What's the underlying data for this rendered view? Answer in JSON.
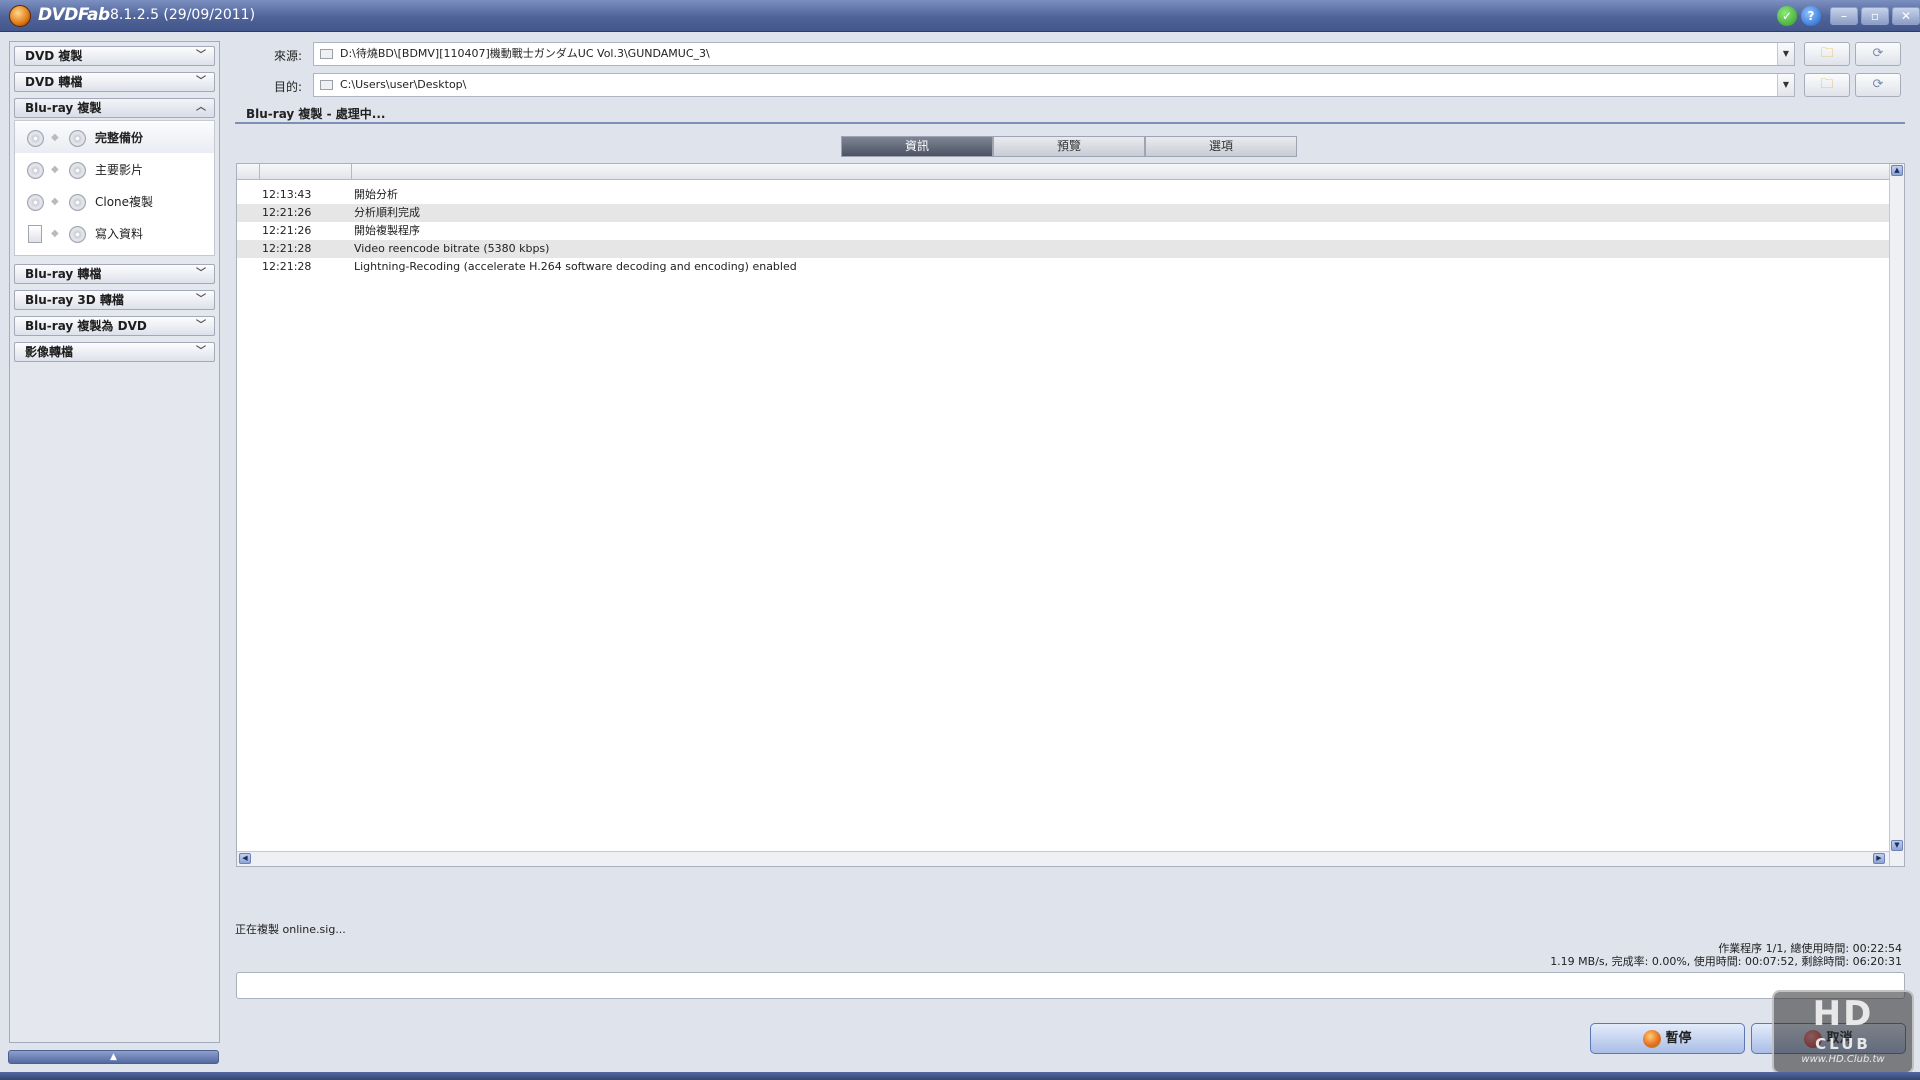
{
  "window": {
    "app_name": "DVDFab",
    "version": "8.1.2.5 (29/09/2011)"
  },
  "sidebar": {
    "categories": {
      "dvd_copy": "DVD 複製",
      "dvd_convert": "DVD 轉檔",
      "bluray_copy": "Blu-ray 複製",
      "bluray_convert": "Blu-ray 轉檔",
      "bluray_3d": "Blu-ray 3D 轉檔",
      "bluray_to_dvd": "Blu-ray 複製為 DVD",
      "video_convert": "影像轉檔"
    },
    "bluray_copy_modes": [
      "完整備份",
      "主要影片",
      "Clone複製",
      "寫入資料"
    ],
    "active_mode": "完整備份"
  },
  "paths": {
    "source_label": "來源:",
    "source_value": "D:\\待燒BD\\[BDMV][110407]機動戰士ガンダムUC Vol.3\\GUNDAMUC_3\\",
    "target_label": "目的:",
    "target_value": "C:\\Users\\user\\Desktop\\"
  },
  "main": {
    "section_title": "Blu-ray 複製 - 處理中...",
    "tabs": [
      "資訊",
      "預覽",
      "選項"
    ],
    "active_tab": "資訊"
  },
  "log": [
    {
      "time": "12:13:43",
      "message": "開始分析"
    },
    {
      "time": "12:21:26",
      "message": "分析順利完成"
    },
    {
      "time": "12:21:26",
      "message": "開始複製程序"
    },
    {
      "time": "12:21:28",
      "message": "Video reencode bitrate (5380 kbps)"
    },
    {
      "time": "12:21:28",
      "message": "Lightning-Recoding (accelerate H.264 software decoding and encoding) enabled"
    }
  ],
  "status": {
    "current_action": "正在複製 online.sig...",
    "stats_line1": "作業程序 1/1, 總使用時間: 00:22:54",
    "stats_line2": "1.19 MB/s, 完成率: 0.00%, 使用時間: 00:07:52, 剩餘時間: 06:20:31",
    "progress_percent": 0
  },
  "buttons": {
    "pause": "暫停",
    "cancel": "取消"
  },
  "watermark": {
    "logo": "HD",
    "sub": "CLUB",
    "url": "www.HD.Club.tw"
  },
  "colors": {
    "titlebar": "#4f6399",
    "active_tab": "#5a6070",
    "row_alt": "#e6e6e6",
    "folder_icon": "#e2a31c"
  }
}
